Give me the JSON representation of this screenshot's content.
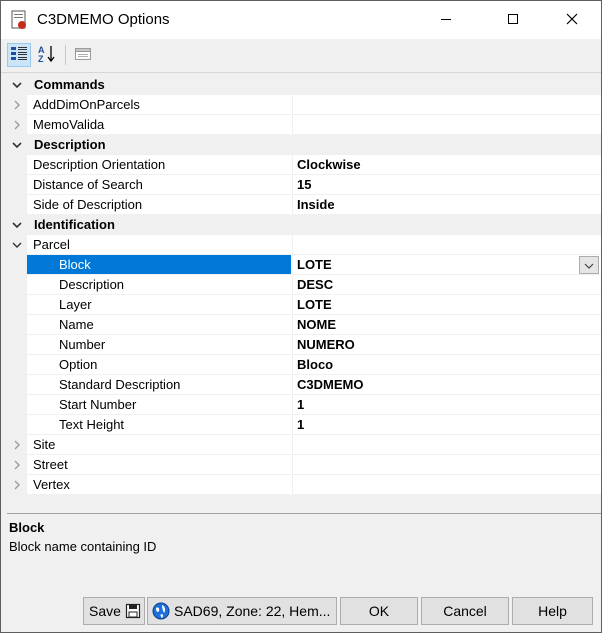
{
  "window": {
    "title": "C3DMEMO Options",
    "controls": {
      "minimize": "minimize-icon",
      "maximize": "maximize-icon",
      "close": "close-icon"
    }
  },
  "toolbar": {
    "categorized_icon": "categorized-icon",
    "alphabetical_icon": "alphabetical-icon",
    "property_pages_icon": "property-pages-icon"
  },
  "grid": {
    "commands": {
      "label": "Commands",
      "items": [
        {
          "name": "AddDimOnParcels",
          "value": ""
        },
        {
          "name": "MemoValida",
          "value": ""
        }
      ]
    },
    "description": {
      "label": "Description",
      "items": [
        {
          "name": "Description Orientation",
          "value": "Clockwise"
        },
        {
          "name": "Distance of Search",
          "value": "15"
        },
        {
          "name": "Side of Description",
          "value": "Inside"
        }
      ]
    },
    "identification": {
      "label": "Identification",
      "parcel": {
        "name": "Parcel",
        "items": [
          {
            "name": "Block",
            "value": "LOTE"
          },
          {
            "name": "Description",
            "value": "DESC"
          },
          {
            "name": "Layer",
            "value": "LOTE"
          },
          {
            "name": "Name",
            "value": "NOME"
          },
          {
            "name": "Number",
            "value": "NUMERO"
          },
          {
            "name": "Option",
            "value": "Bloco"
          },
          {
            "name": "Standard Description",
            "value": "C3DMEMO"
          },
          {
            "name": "Start Number",
            "value": "1"
          },
          {
            "name": "Text Height",
            "value": "1"
          }
        ]
      },
      "items": [
        {
          "name": "Site",
          "value": ""
        },
        {
          "name": "Street",
          "value": ""
        },
        {
          "name": "Vertex",
          "value": ""
        }
      ]
    },
    "selected": "Block"
  },
  "help": {
    "title": "Block",
    "description": "Block name containing ID"
  },
  "buttons": {
    "save": "Save",
    "coordinate_system": "SAD69, Zone: 22, Hem...",
    "ok": "OK",
    "cancel": "Cancel",
    "help": "Help"
  },
  "colors": {
    "selection": "#0078d7",
    "accent_red": "#c42b1c"
  }
}
